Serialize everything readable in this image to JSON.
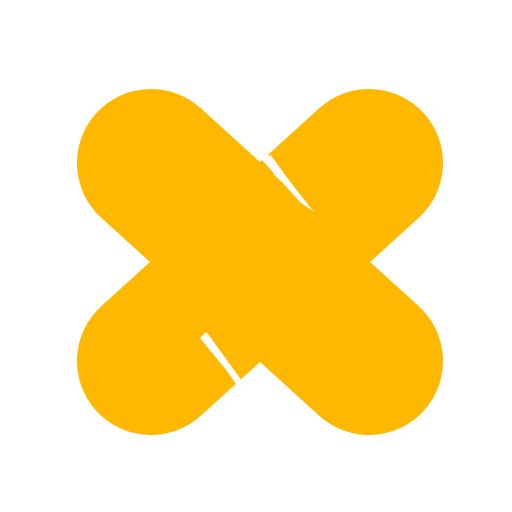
{
  "logo": {
    "name": "yellow-x-logo",
    "fill_color": "#FFB800",
    "gap_color": "#FFFFFF",
    "background_color": "#FFFFFF"
  }
}
